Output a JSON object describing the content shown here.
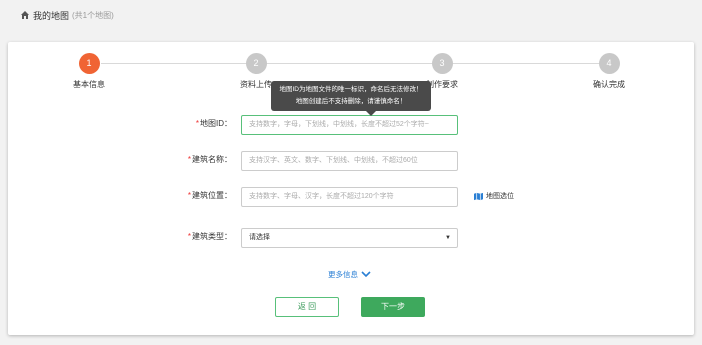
{
  "header": {
    "title": "我的地图",
    "count": "(共1个地图)"
  },
  "steps": [
    {
      "number": "1",
      "label": "基本信息",
      "active": true
    },
    {
      "number": "2",
      "label": "资料上传",
      "active": false
    },
    {
      "number": "3",
      "label": "制作要求",
      "active": false
    },
    {
      "number": "4",
      "label": "确认完成",
      "active": false
    }
  ],
  "tooltip": {
    "line1": "地图ID为地图文件的唯一标识，命名后无法修改！",
    "line2": "地图创建后不支持删除，请谨慎命名！"
  },
  "form": {
    "map_id": {
      "label": "地图ID：",
      "placeholder": "支持数字，字母，下划线，中划线，长度不超过52个字符~"
    },
    "building_name": {
      "label": "建筑名称：",
      "placeholder": "支持汉字、英文、数字、下划线、中划线，不超过60位"
    },
    "building_location": {
      "label": "建筑位置：",
      "placeholder": "支持数字、字母、汉字，长度不超过120个字符"
    },
    "map_pick": "地图选位",
    "building_type": {
      "label": "建筑类型：",
      "value": "请选择",
      "arrow": "▼"
    }
  },
  "more_info": "更多信息",
  "buttons": {
    "back": "返 回",
    "next": "下一步"
  },
  "colors": {
    "active_step": "#f06434",
    "primary_green": "#3ea95d",
    "link_blue": "#2a7fd4",
    "required": "#e33333"
  }
}
